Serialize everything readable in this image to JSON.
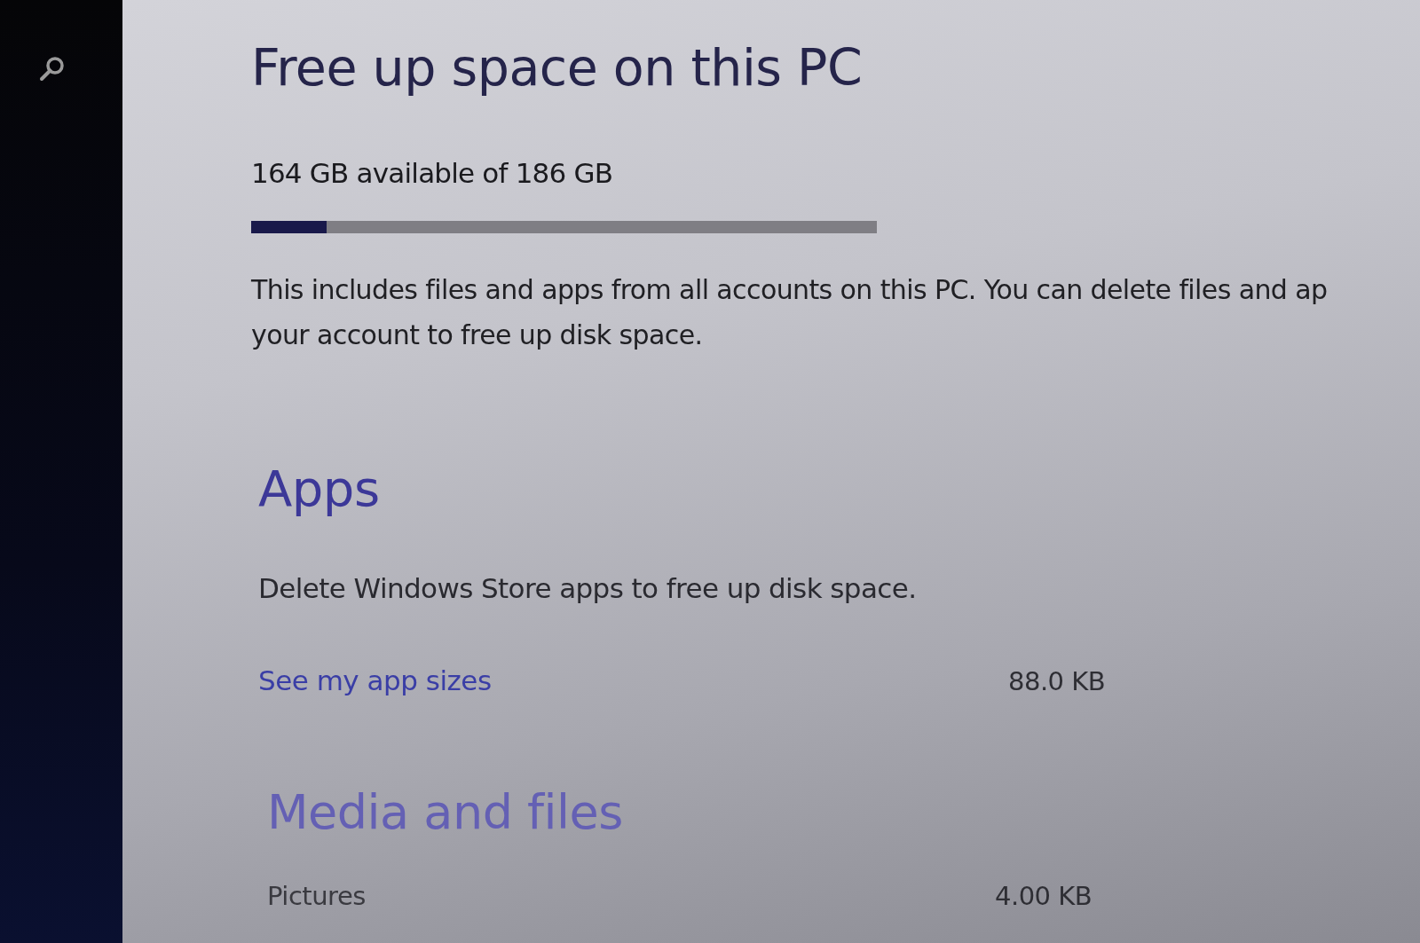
{
  "page": {
    "title": "Free up space on this PC",
    "storage": {
      "summary": "164 GB available of 186 GB",
      "level": 0.12
    },
    "description": "This includes files and apps from all accounts on this PC. You can delete files and ap\nyour account to free up disk space."
  },
  "sections": [
    {
      "heading": "Apps",
      "description": "Delete Windows Store apps to free up disk space.",
      "items": [
        {
          "kind": "link",
          "label": "See my app sizes",
          "size": "88.0 KB"
        }
      ]
    },
    {
      "heading": "Media and files",
      "items": [
        {
          "kind": "text",
          "label": "Pictures",
          "size": "4.00 KB"
        }
      ]
    }
  ]
}
